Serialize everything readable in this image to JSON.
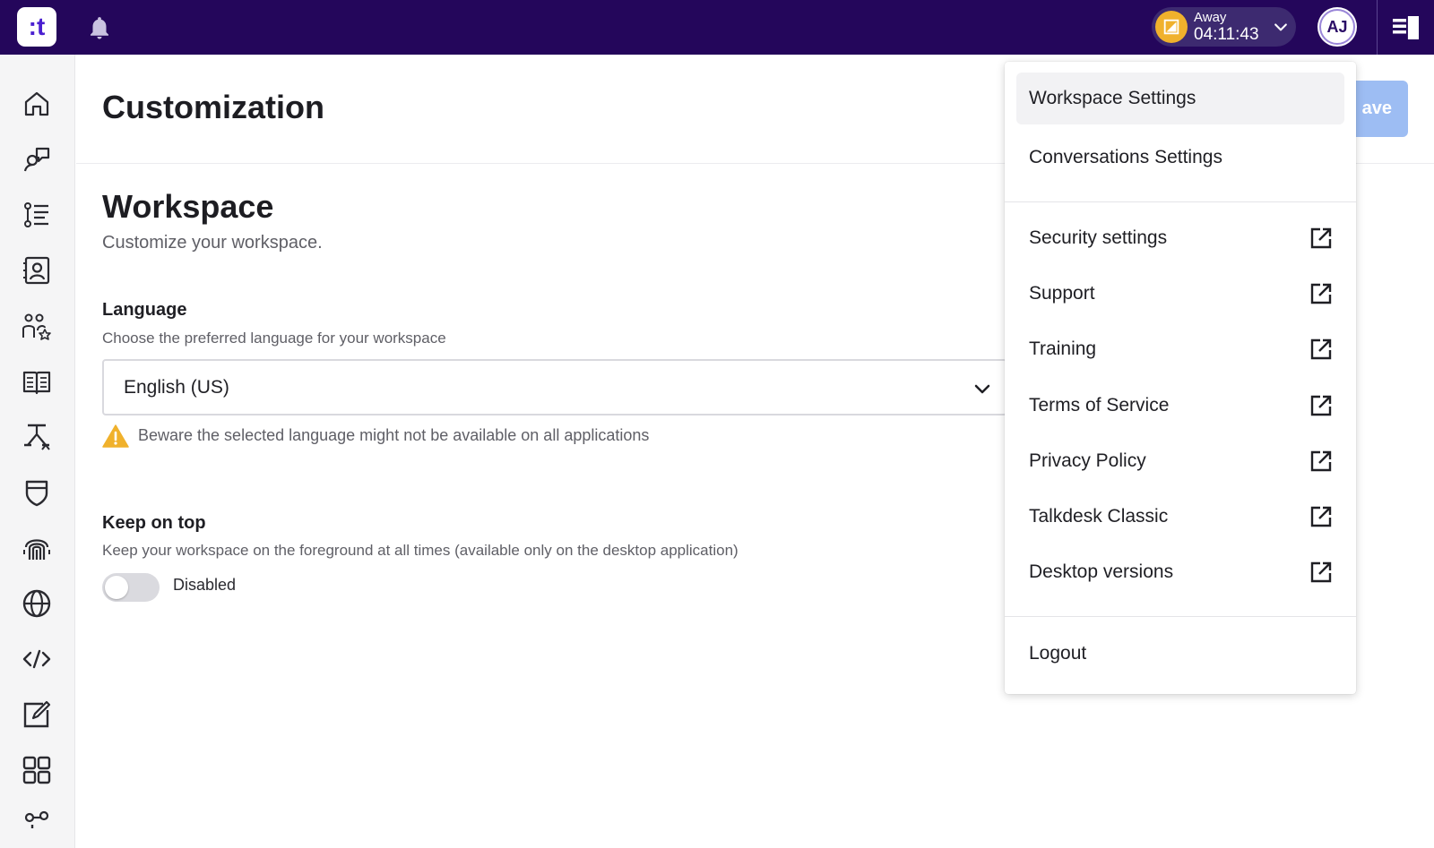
{
  "topbar": {
    "logo_text": ":t",
    "status": {
      "label": "Away",
      "timer": "04:11:43",
      "color": "#f0b12c"
    },
    "avatar_initials": "AJ",
    "background": "#24065b"
  },
  "sidebar": {
    "items": [
      {
        "name": "home-icon"
      },
      {
        "name": "conversations-icon"
      },
      {
        "name": "activity-list-icon"
      },
      {
        "name": "contacts-icon"
      },
      {
        "name": "team-icon"
      },
      {
        "name": "knowledge-icon"
      },
      {
        "name": "workflow-icon"
      },
      {
        "name": "shield-icon"
      },
      {
        "name": "fingerprint-icon"
      },
      {
        "name": "globe-icon"
      },
      {
        "name": "code-icon"
      },
      {
        "name": "edit-icon"
      },
      {
        "name": "apps-grid-icon"
      },
      {
        "name": "analytics-icon"
      }
    ]
  },
  "header": {
    "title": "Customization",
    "save_label": "ave"
  },
  "workspace": {
    "title": "Workspace",
    "subtitle": "Customize your workspace.",
    "language": {
      "label": "Language",
      "description": "Choose the preferred language for your workspace",
      "value": "English (US)",
      "warning": "Beware the selected language might not be available on all applications"
    },
    "keep_on_top": {
      "label": "Keep on top",
      "description": "Keep your workspace on the foreground at all times (available only on the desktop application)",
      "state_label": "Disabled"
    }
  },
  "menu": {
    "settings_items": [
      {
        "label": "Workspace Settings"
      },
      {
        "label": "Conversations Settings"
      }
    ],
    "external_items": [
      {
        "label": "Security settings"
      },
      {
        "label": "Support"
      },
      {
        "label": "Training"
      },
      {
        "label": "Terms of Service"
      },
      {
        "label": "Privacy Policy"
      },
      {
        "label": "Talkdesk Classic"
      },
      {
        "label": "Desktop versions"
      }
    ],
    "logout_label": "Logout"
  },
  "colors": {
    "accent": "#9dbdf3",
    "warning": "#f0b12c"
  }
}
